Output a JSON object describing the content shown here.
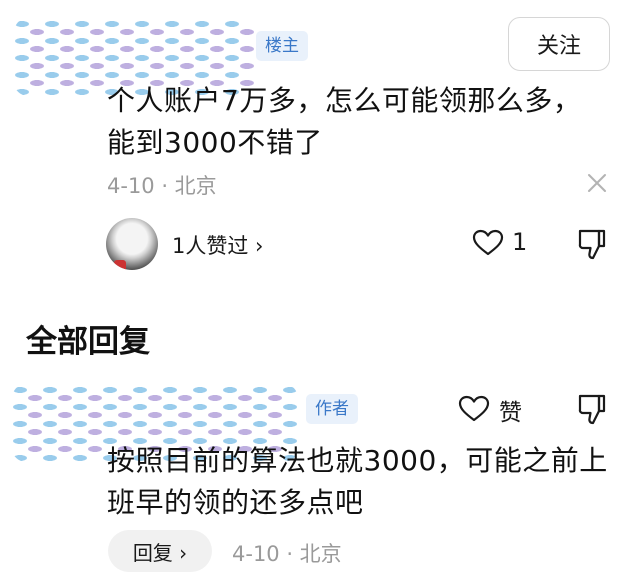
{
  "top_comment": {
    "badge": "楼主",
    "follow_label": "关注",
    "text": "个人账户7万多，怎么可能领那么多，能到3000不错了",
    "meta": "4-10 · 北京",
    "likers_label": "1人赞过 ›",
    "like_count": "1"
  },
  "replies_section": {
    "title": "全部回复"
  },
  "reply": {
    "badge": "作者",
    "like_label": "赞",
    "text": "按照目前的算法也就3000，可能之前上班早的领的还多点吧",
    "reply_button_label": "回复 ›",
    "meta": "4-10 · 北京"
  },
  "colors": {
    "badge_text": "#3a78c8",
    "badge_bg": "#e9f1fb",
    "meta_text": "#9a9a9a"
  }
}
